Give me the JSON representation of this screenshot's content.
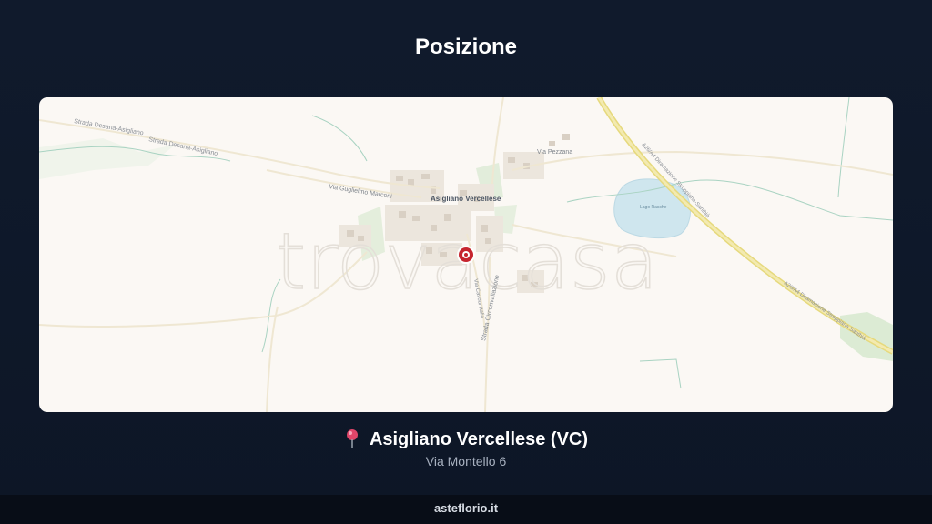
{
  "header": {
    "title": "Posizione"
  },
  "map": {
    "watermark": "trovacasa",
    "town_label": "Asigliano Vercellese",
    "road_labels": {
      "strada_desana_1": "Strada Desana-Asigliano",
      "strada_desana_2": "Strada Desana-Asigliano",
      "via_marconi": "Via Guglielmo Marconi",
      "via_pezzana": "Via Pezzana",
      "via_montello": "Via Cavour Italia",
      "strada_circonvallazione": "Strada Circonvallazione",
      "autostrada_1": "A26/A4 Diramazione Stroppiana-Santhià",
      "autostrada_2": "A26/A4 Diramazione Stroppiana-Santhià",
      "lago": "Lago Rasche"
    },
    "marker_icon": "location-marker-icon",
    "colors": {
      "land": "#fbf8f4",
      "highway": "#e8dc8a",
      "water": "#cfe6ee",
      "green": "#dcebd4",
      "marker": "#c6252f"
    }
  },
  "location": {
    "pin_icon": "pin-icon",
    "name": "Asigliano Vercellese (VC)",
    "address": "Via Montello 6"
  },
  "footer": {
    "brand": "asteflorio.it"
  }
}
